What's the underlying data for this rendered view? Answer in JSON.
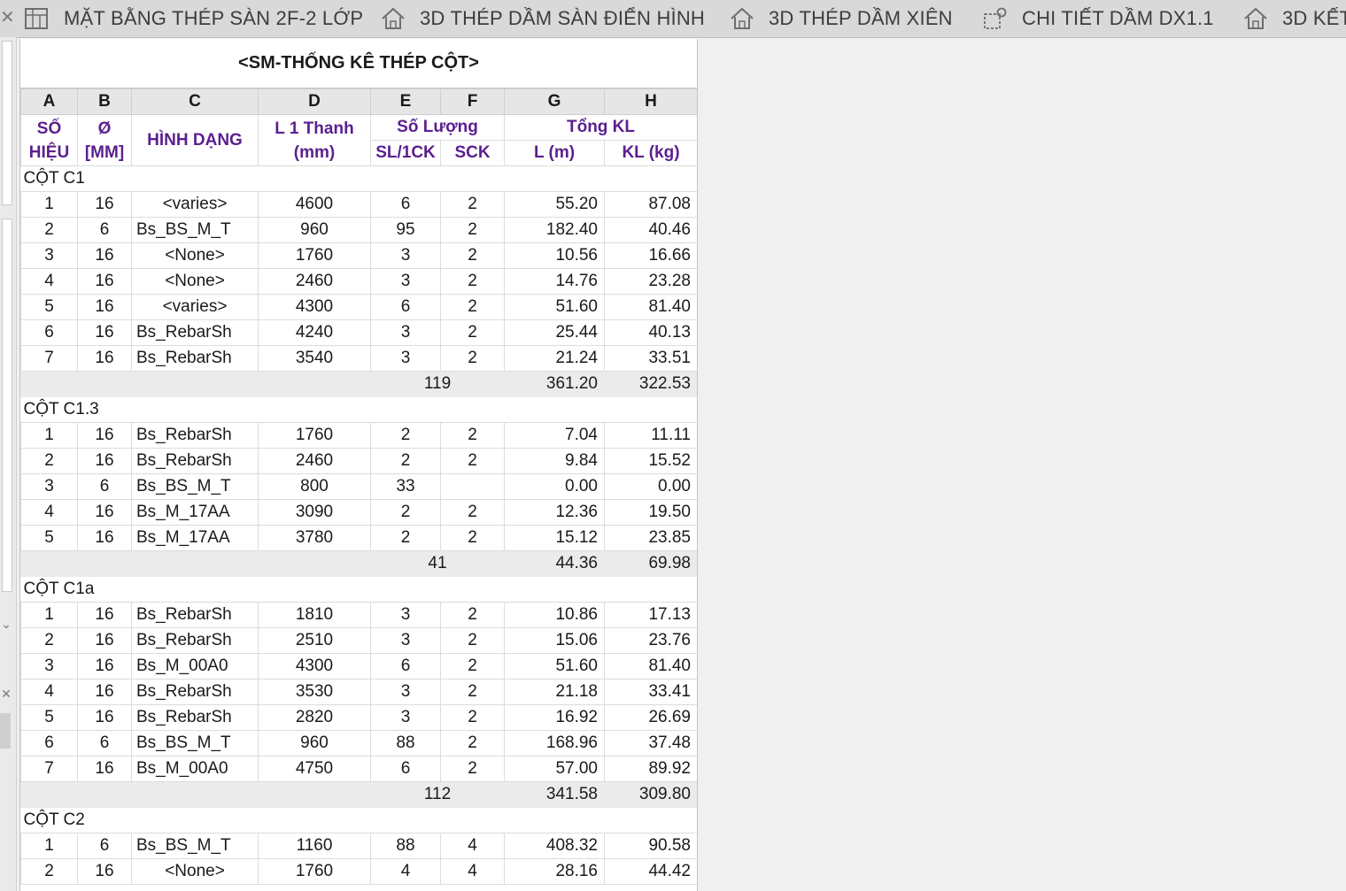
{
  "tabs": [
    {
      "label": "MẶT BẰNG THÉP SÀN 2F-2 LỚP",
      "icon": "floor-plan-icon"
    },
    {
      "label": "3D THÉP DẦM SÀN ĐIỂN HÌNH",
      "icon": "house-3d-icon"
    },
    {
      "label": "3D THÉP DẦM XIÊN",
      "icon": "house-3d-icon"
    },
    {
      "label": "CHI TIẾT DẦM DX1.1",
      "icon": "detail-view-icon"
    },
    {
      "label": "3D KẾT",
      "icon": "house-3d-icon"
    }
  ],
  "schedule": {
    "title": "<SM-THỐNG KÊ THÉP CỘT>",
    "column_letters": [
      "A",
      "B",
      "C",
      "D",
      "E",
      "F",
      "G",
      "H"
    ],
    "headers": {
      "so_hieu": "SỐ HIỆU",
      "phi": "Ø [MM]",
      "hinh_dang": "HÌNH DẠNG",
      "l1": "L 1 Thanh (mm)",
      "so_luong": "Số Lượng",
      "sl1ck": "SL/1CK",
      "sck": "SCK",
      "tong_kl": "Tổng KL",
      "l_m": "L (m)",
      "kl_kg": "KL (kg)"
    },
    "groups": [
      {
        "name": "CỘT C1",
        "rows": [
          [
            "1",
            "16",
            "<varies>",
            "4600",
            "6",
            "2",
            "55.20",
            "87.08"
          ],
          [
            "2",
            "6",
            "Bs_BS_M_T",
            "960",
            "95",
            "2",
            "182.40",
            "40.46"
          ],
          [
            "3",
            "16",
            "<None>",
            "1760",
            "3",
            "2",
            "10.56",
            "16.66"
          ],
          [
            "4",
            "16",
            "<None>",
            "2460",
            "3",
            "2",
            "14.76",
            "23.28"
          ],
          [
            "5",
            "16",
            "<varies>",
            "4300",
            "6",
            "2",
            "51.60",
            "81.40"
          ],
          [
            "6",
            "16",
            "Bs_RebarSh",
            "4240",
            "3",
            "2",
            "25.44",
            "40.13"
          ],
          [
            "7",
            "16",
            "Bs_RebarSh",
            "3540",
            "3",
            "2",
            "21.24",
            "33.51"
          ]
        ],
        "total": {
          "count": "119",
          "length": "361.20",
          "weight": "322.53"
        }
      },
      {
        "name": "CỘT C1.3",
        "rows": [
          [
            "1",
            "16",
            "Bs_RebarSh",
            "1760",
            "2",
            "2",
            "7.04",
            "11.11"
          ],
          [
            "2",
            "16",
            "Bs_RebarSh",
            "2460",
            "2",
            "2",
            "9.84",
            "15.52"
          ],
          [
            "3",
            "6",
            "Bs_BS_M_T",
            "800",
            "33",
            "",
            "0.00",
            "0.00"
          ],
          [
            "4",
            "16",
            "Bs_M_17AA",
            "3090",
            "2",
            "2",
            "12.36",
            "19.50"
          ],
          [
            "5",
            "16",
            "Bs_M_17AA",
            "3780",
            "2",
            "2",
            "15.12",
            "23.85"
          ]
        ],
        "total": {
          "count": "41",
          "length": "44.36",
          "weight": "69.98"
        }
      },
      {
        "name": "CỘT C1a",
        "rows": [
          [
            "1",
            "16",
            "Bs_RebarSh",
            "1810",
            "3",
            "2",
            "10.86",
            "17.13"
          ],
          [
            "2",
            "16",
            "Bs_RebarSh",
            "2510",
            "3",
            "2",
            "15.06",
            "23.76"
          ],
          [
            "3",
            "16",
            "Bs_M_00A0",
            "4300",
            "6",
            "2",
            "51.60",
            "81.40"
          ],
          [
            "4",
            "16",
            "Bs_RebarSh",
            "3530",
            "3",
            "2",
            "21.18",
            "33.41"
          ],
          [
            "5",
            "16",
            "Bs_RebarSh",
            "2820",
            "3",
            "2",
            "16.92",
            "26.69"
          ],
          [
            "6",
            "6",
            "Bs_BS_M_T",
            "960",
            "88",
            "2",
            "168.96",
            "37.48"
          ],
          [
            "7",
            "16",
            "Bs_M_00A0",
            "4750",
            "6",
            "2",
            "57.00",
            "89.92"
          ]
        ],
        "total": {
          "count": "112",
          "length": "341.58",
          "weight": "309.80"
        }
      },
      {
        "name": "CỘT C2",
        "rows": [
          [
            "1",
            "6",
            "Bs_BS_M_T",
            "1160",
            "88",
            "4",
            "408.32",
            "90.58"
          ],
          [
            "2",
            "16",
            "<None>",
            "1760",
            "4",
            "4",
            "28.16",
            "44.42"
          ]
        ]
      }
    ]
  }
}
